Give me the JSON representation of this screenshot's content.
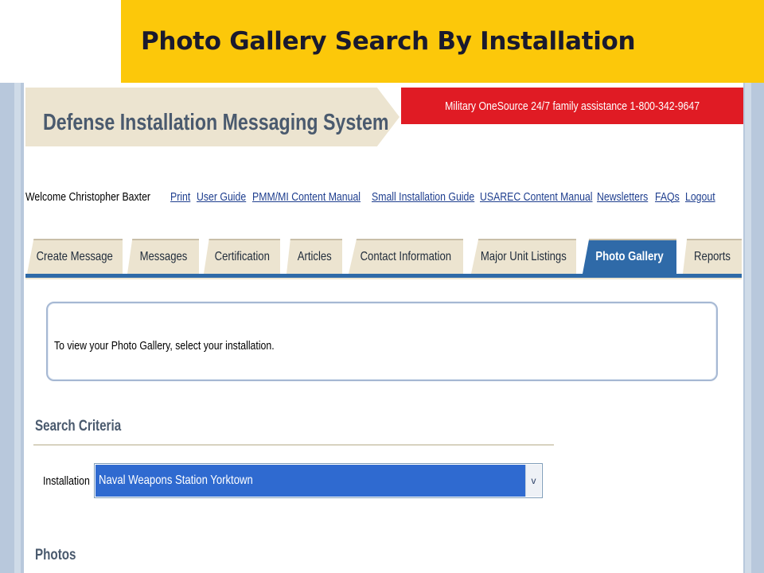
{
  "slide": {
    "title": "Photo Gallery Search By Installation"
  },
  "header": {
    "brand": "Defense Installation Messaging System",
    "banner": "Military OneSource 24/7 family assistance 1-800-342-9647"
  },
  "nav": {
    "welcome": "Welcome Christopher Baxter",
    "links": [
      "Print",
      "User Guide",
      "PMM/MI Content Manual",
      "Small Installation Guide",
      "USAREC Content Manual",
      "Newsletters",
      "FAQs",
      "Logout"
    ]
  },
  "tabs": [
    {
      "label": "Create Message",
      "active": false
    },
    {
      "label": "Messages",
      "active": false
    },
    {
      "label": "Certification",
      "active": false
    },
    {
      "label": "Articles",
      "active": false
    },
    {
      "label": "Contact Information",
      "active": false
    },
    {
      "label": "Major Unit Listings",
      "active": false
    },
    {
      "label": "Photo Gallery",
      "active": true
    },
    {
      "label": "Reports",
      "active": false
    }
  ],
  "info": {
    "text": "To view your Photo Gallery, select your installation."
  },
  "search": {
    "title": "Search Criteria",
    "installation_label": "Installation",
    "installation_value": "Naval Weapons Station Yorktown",
    "dropdown_arrow": "v"
  },
  "photos": {
    "title": "Photos"
  },
  "colors": {
    "title_bar": "#fcc80a",
    "banner": "#e01b24",
    "active_tab": "#2f6aa8",
    "tab": "#ece4d0",
    "select_highlight": "#2f6ad0",
    "link": "#1f3f8f"
  }
}
